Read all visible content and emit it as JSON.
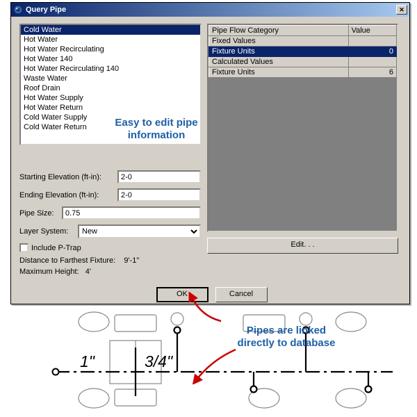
{
  "title": "Query Pipe",
  "types": [
    "Cold Water",
    "Hot Water",
    "Hot Water Recirculating",
    "Hot Water 140",
    "Hot Water Recirculating 140",
    "Waste Water",
    "Roof Drain",
    "Hot Water Supply",
    "Hot Water Return",
    "Cold Water Supply",
    "Cold Water Return"
  ],
  "types_selected": 0,
  "grid": {
    "cols": [
      "Pipe Flow Category",
      "Value"
    ],
    "rows": [
      {
        "label": "Fixed Values",
        "value": "",
        "header": true
      },
      {
        "label": "Fixture Units",
        "value": "0",
        "sel": true
      },
      {
        "label": "Calculated Values",
        "value": "",
        "header": true
      },
      {
        "label": "Fixture Units",
        "value": "6"
      }
    ]
  },
  "form": {
    "starting_label": "Starting Elevation (ft-in):",
    "starting_val": "2-0",
    "ending_label": "Ending Elevation (ft-in):",
    "ending_val": "2-0",
    "size_label": "Pipe Size:",
    "size_val": "0.75",
    "layer_label": "Layer System:",
    "layer_val": "New",
    "ptrap_label": "Include P-Trap",
    "dist_label": "Distance to Farthest Fixture:",
    "dist_val": "9'-1\"",
    "maxh_label": "Maximum Height:",
    "maxh_val": "4'"
  },
  "buttons": {
    "edit": "Edit. . .",
    "ok": "OK",
    "cancel": "Cancel"
  },
  "annot1": "Easy to edit pipe\ninformation",
  "annot2": "Pipes are linked\ndirectly to database",
  "drawing": {
    "label1": "1\"",
    "label2": "3/4\""
  }
}
